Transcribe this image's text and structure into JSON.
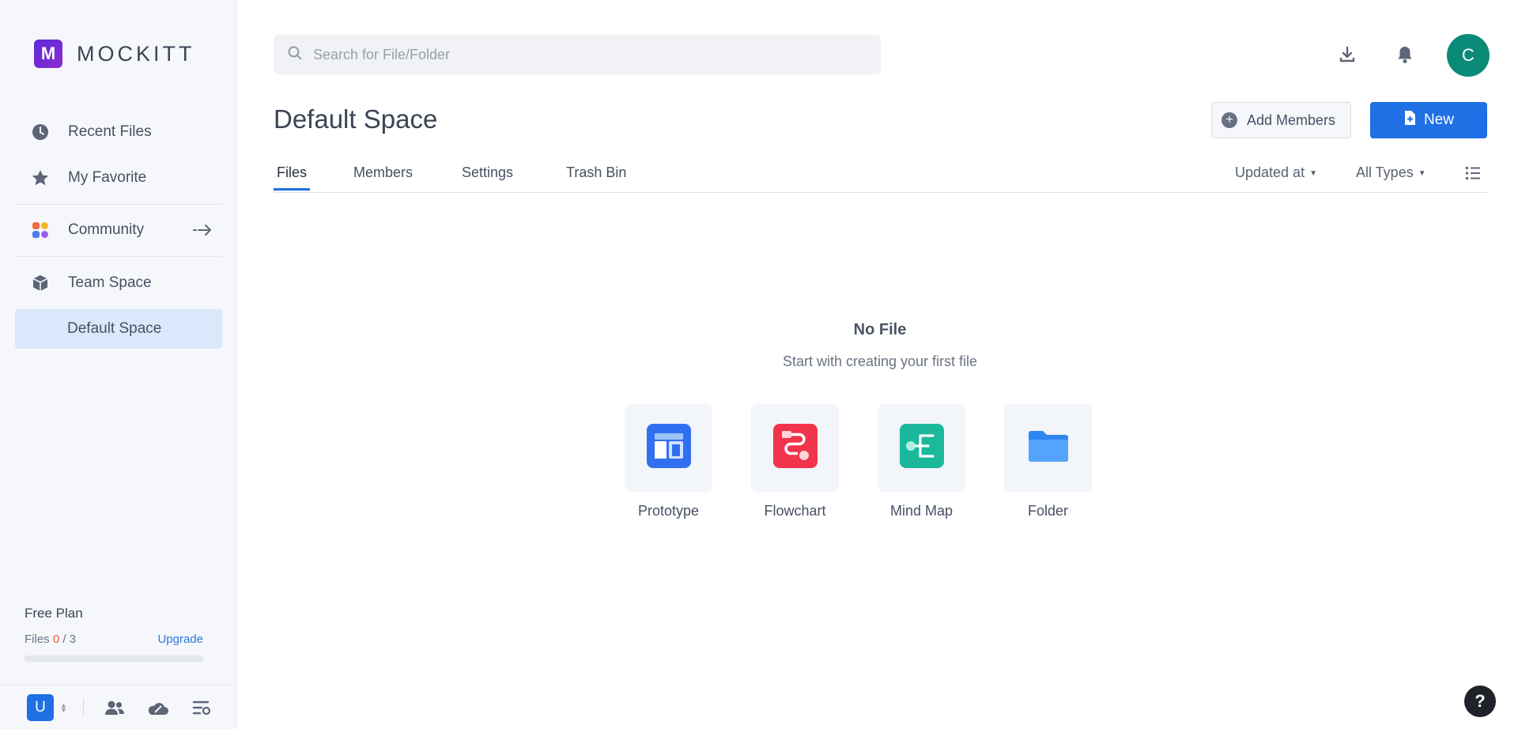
{
  "app": {
    "logo_letter": "M",
    "name": "MOCKITT",
    "brand_color": "#6a2ad6"
  },
  "sidebar": {
    "nav": [
      {
        "label": "Recent Files",
        "icon": "clock-icon"
      },
      {
        "label": "My Favorite",
        "icon": "star-icon"
      },
      {
        "label": "Community",
        "icon": "community-icon"
      },
      {
        "label": "Team Space",
        "icon": "cube-icon"
      },
      {
        "label": "Default Space",
        "icon": ""
      }
    ],
    "plan": {
      "title": "Free Plan",
      "files_label": "Files",
      "files_used": "0",
      "files_separator": "/",
      "files_limit": "3",
      "upgrade": "Upgrade",
      "usage_fraction": 0
    },
    "footer": {
      "user_initial": "U"
    }
  },
  "search": {
    "placeholder": "Search for File/Folder"
  },
  "header": {
    "avatar_initial": "C",
    "avatar_color": "#0c8a78"
  },
  "page": {
    "title": "Default Space",
    "add_members": "Add Members",
    "new_button": "New",
    "tabs": [
      "Files",
      "Members",
      "Settings",
      "Trash Bin"
    ],
    "active_tab": "Files",
    "sort_label": "Updated at",
    "type_filter": "All Types"
  },
  "empty": {
    "title": "No File",
    "subtitle": "Start with creating your first file",
    "options": [
      {
        "label": "Prototype",
        "icon": "prototype-icon"
      },
      {
        "label": "Flowchart",
        "icon": "flowchart-icon"
      },
      {
        "label": "Mind Map",
        "icon": "mind-map-icon"
      },
      {
        "label": "Folder",
        "icon": "folder-icon"
      }
    ]
  },
  "help": {
    "label": "?"
  }
}
